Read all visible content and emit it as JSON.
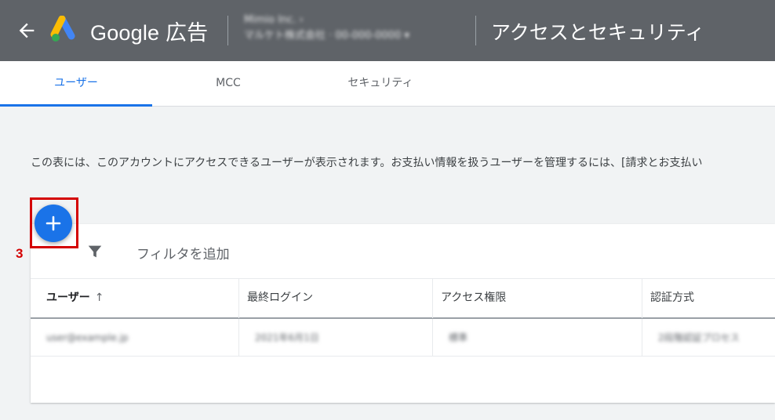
{
  "header": {
    "brand": "Google 広告",
    "account_line1": "Mimio Inc. ›",
    "account_line2": "マルケト株式会社 · 00-000-0000 ▾",
    "page_title": "アクセスとセキュリティ"
  },
  "tabs": [
    {
      "label": "ユーザー",
      "active": true
    },
    {
      "label": "MCC",
      "active": false
    },
    {
      "label": "セキュリティ",
      "active": false
    }
  ],
  "description": "この表には、このアカウントにアクセスできるユーザーが表示されます。お支払い情報を扱うユーザーを管理するには、[請求とお支払い",
  "filter": {
    "label": "フィルタを追加"
  },
  "table": {
    "columns": [
      "ユーザー",
      "最終ログイン",
      "アクセス権限",
      "認証方式"
    ],
    "rows": [
      [
        "user@example.jp",
        "2021年6月1日",
        "標準",
        "2段階認証プロセス"
      ]
    ]
  },
  "annotation": {
    "step": "3"
  },
  "colors": {
    "accent": "#1a73e8",
    "header": "#5f6368",
    "highlight": "#d40000"
  }
}
